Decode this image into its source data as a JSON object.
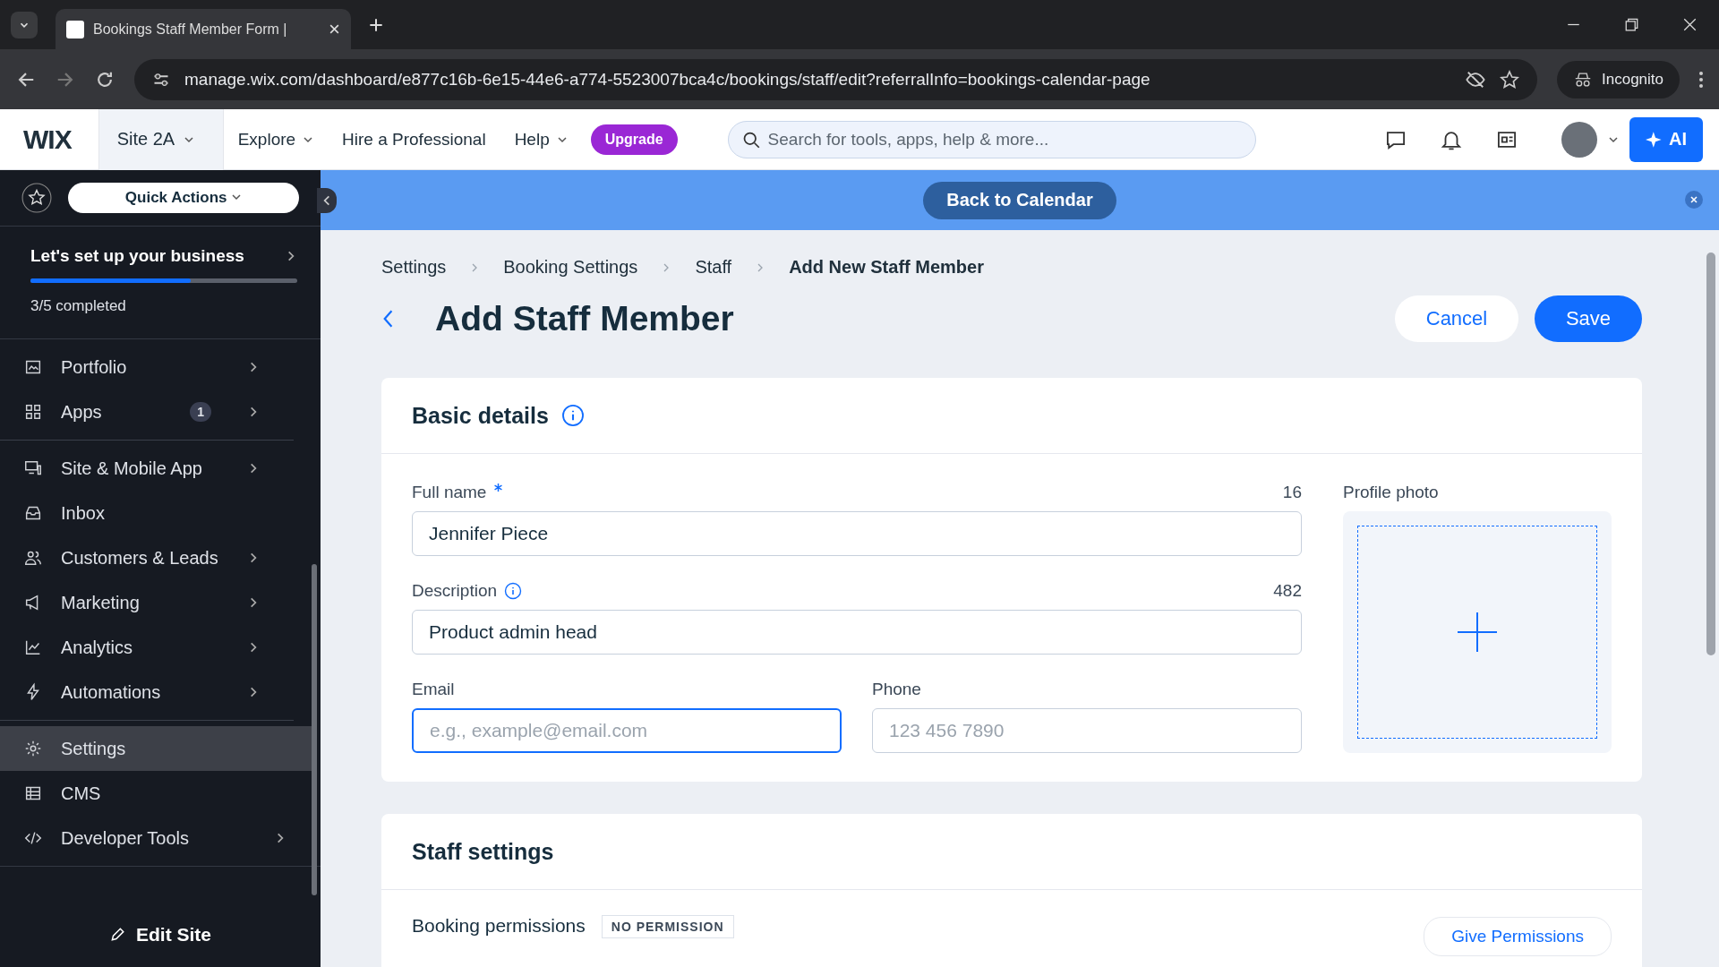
{
  "browser": {
    "tab_title": "Bookings Staff Member Form |",
    "url": "manage.wix.com/dashboard/e877c16b-6e15-44e6-a774-5523007bca4c/bookings/staff/edit?referralInfo=bookings-calendar-page",
    "incognito": "Incognito"
  },
  "header": {
    "logo": "WIX",
    "site": "Site 2A",
    "nav": [
      {
        "label": "Explore",
        "dropdown": true
      },
      {
        "label": "Hire a Professional",
        "dropdown": false
      },
      {
        "label": "Help",
        "dropdown": true
      }
    ],
    "upgrade": "Upgrade",
    "search": {
      "placeholder": "Search for tools, apps, help & more..."
    },
    "ai": "AI"
  },
  "sidebar": {
    "quick_actions": "Quick Actions",
    "setup": {
      "title": "Let's set up your business",
      "level": 0.6,
      "progress": "3/5 completed"
    },
    "sections": [
      [
        {
          "label": "Portfolio",
          "chevron": true,
          "selected": false
        },
        {
          "label": "Apps",
          "badge": "1",
          "chevron": true,
          "selected": false
        }
      ],
      [
        {
          "label": "Site & Mobile App",
          "chevron": true,
          "selected": false
        },
        {
          "label": "Inbox",
          "chevron": false,
          "selected": false
        },
        {
          "label": "Customers & Leads",
          "chevron": true,
          "selected": false
        },
        {
          "label": "Marketing",
          "chevron": true,
          "selected": false
        },
        {
          "label": "Analytics",
          "chevron": true,
          "selected": false
        },
        {
          "label": "Automations",
          "chevron": true,
          "selected": false
        }
      ],
      [
        {
          "label": "Settings",
          "chevron": false,
          "selected": true
        },
        {
          "label": "CMS",
          "chevron": false,
          "selected": false
        },
        {
          "label": "Developer Tools",
          "chevron": true,
          "selected": false
        }
      ]
    ],
    "edit_site": "Edit Site"
  },
  "banner": {
    "button": "Back to Calendar"
  },
  "breadcrumbs": [
    "Settings",
    "Booking Settings",
    "Staff",
    "Add New Staff Member"
  ],
  "title": "Add Staff Member",
  "cancel": "Cancel",
  "save": "Save",
  "basic_details": {
    "title": "Basic details",
    "full_name": {
      "label": "Full name",
      "required": true,
      "count": "16",
      "value": "Jennifer Piece"
    },
    "description": {
      "label": "Description",
      "count": "482",
      "value": "Product admin head"
    },
    "email": {
      "label": "Email",
      "placeholder": "e.g., example@email.com",
      "focused": true
    },
    "phone": {
      "label": "Phone",
      "placeholder": "123 456 7890",
      "focused": false
    },
    "profile_photo": "Profile photo"
  },
  "staff_settings": {
    "title": "Staff settings",
    "permissions_label": "Booking permissions",
    "permissions_badge": "NO PERMISSION",
    "give_permissions": "Give Permissions"
  }
}
